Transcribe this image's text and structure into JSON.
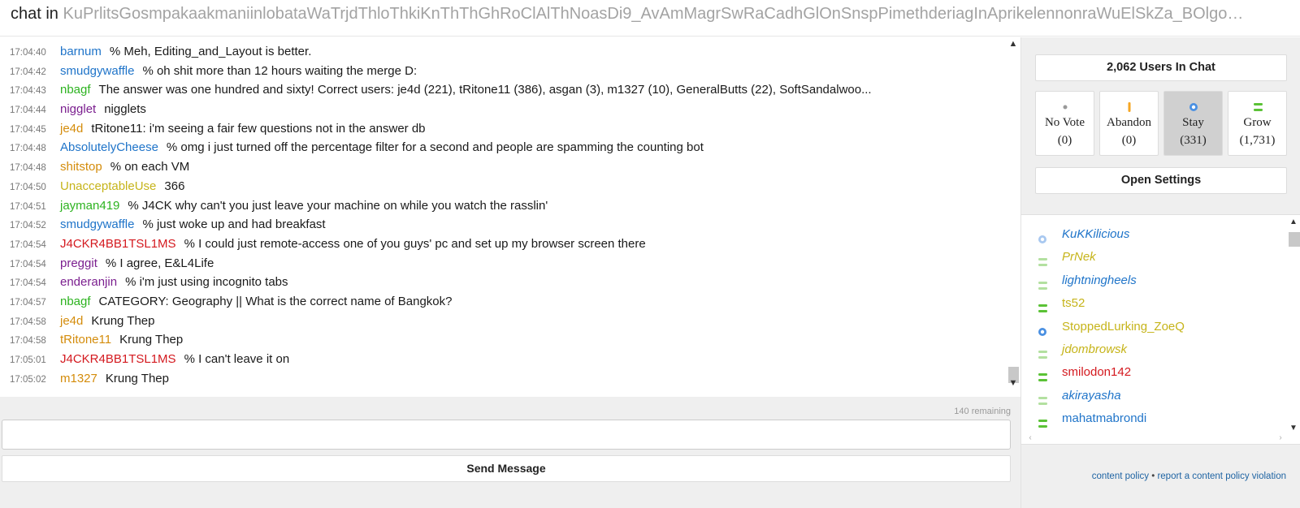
{
  "header": {
    "prefix": "chat in",
    "room": "KuPrlitsGosmpakaakmaniinlobataWaTrjdThloThkiKnThThGhRoClAlThNoasDi9_AvAmMagrSwRaCadhGlOnSnspPimethderiagInAprikelennonraWuElSkZa_BOlgo…"
  },
  "messages": [
    {
      "time": "17:04:40",
      "user": "barnum",
      "color": "#1f74c9",
      "text": "% Meh, Editing_and_Layout is better."
    },
    {
      "time": "17:04:42",
      "user": "smudgywaffle",
      "color": "#1f74c9",
      "text": "% oh shit more than 12 hours waiting the merge D:"
    },
    {
      "time": "17:04:43",
      "user": "nbagf",
      "color": "#2db320",
      "text": "The answer was one hundred and sixty! Correct users: je4d (221), tRitone11 (386), asgan (3), m1327 (10), GeneralButts (22), SoftSandalwoo..."
    },
    {
      "time": "17:04:44",
      "user": "nigglet",
      "color": "#7b1f8f",
      "text": "nigglets"
    },
    {
      "time": "17:04:45",
      "user": "je4d",
      "color": "#d48c0b",
      "text": "tRitone11: i'm seeing a fair few questions not in the answer db"
    },
    {
      "time": "17:04:48",
      "user": "AbsolutelyCheese",
      "color": "#1f74c9",
      "text": "% omg i just turned off the percentage filter for a second and people are spamming the counting bot"
    },
    {
      "time": "17:04:48",
      "user": "shitstop",
      "color": "#d48c0b",
      "text": "% on each VM"
    },
    {
      "time": "17:04:50",
      "user": "UnacceptableUse",
      "color": "#c6b41a",
      "text": "366"
    },
    {
      "time": "17:04:51",
      "user": "jayman419",
      "color": "#2db320",
      "text": "% J4CK why can't you just leave your machine on while you watch the rasslin'"
    },
    {
      "time": "17:04:52",
      "user": "smudgywaffle",
      "color": "#1f74c9",
      "text": "% just woke up and had breakfast"
    },
    {
      "time": "17:04:54",
      "user": "J4CKR4BB1TSL1MS",
      "color": "#d4191f",
      "text": "% I could just remote-access one of you guys' pc and set up my browser screen there"
    },
    {
      "time": "17:04:54",
      "user": "preggit",
      "color": "#7b1f8f",
      "text": "% I agree, E&L4Life"
    },
    {
      "time": "17:04:54",
      "user": "enderanjin",
      "color": "#7b1f8f",
      "text": "% i'm just using incognito tabs"
    },
    {
      "time": "17:04:57",
      "user": "nbagf",
      "color": "#2db320",
      "text": "CATEGORY: Geography || What is the correct name of Bangkok?"
    },
    {
      "time": "17:04:58",
      "user": "je4d",
      "color": "#d48c0b",
      "text": "Krung Thep"
    },
    {
      "time": "17:04:58",
      "user": "tRitone11",
      "color": "#d48c0b",
      "text": "Krung Thep"
    },
    {
      "time": "17:05:01",
      "user": "J4CKR4BB1TSL1MS",
      "color": "#d4191f",
      "text": "% I can't leave it on"
    },
    {
      "time": "17:05:02",
      "user": "m1327",
      "color": "#d48c0b",
      "text": "Krung Thep"
    }
  ],
  "input": {
    "remaining": "140 remaining",
    "placeholder": "",
    "value": "",
    "send_label": "Send Message"
  },
  "sidebar": {
    "user_count": "2,062 Users In Chat",
    "votes": [
      {
        "label": "No Vote",
        "count": "(0)",
        "icon": "dot-icon",
        "selected": false
      },
      {
        "label": "Abandon",
        "count": "(0)",
        "icon": "abandon-icon",
        "selected": false
      },
      {
        "label": "Stay",
        "count": "(331)",
        "icon": "stay-icon",
        "selected": true
      },
      {
        "label": "Grow",
        "count": "(1,731)",
        "icon": "grow-icon",
        "selected": false
      }
    ],
    "settings_label": "Open Settings",
    "users": [
      {
        "name": "KuKKilicious",
        "color": "#1f74c9",
        "italic": true,
        "icon": "stay-icon",
        "faded": true
      },
      {
        "name": "PrNek",
        "color": "#c6b41a",
        "italic": true,
        "icon": "grow-icon",
        "faded": true
      },
      {
        "name": "lightningheels",
        "color": "#1f74c9",
        "italic": true,
        "icon": "grow-icon",
        "faded": true
      },
      {
        "name": "ts52",
        "color": "#c6b41a",
        "italic": false,
        "icon": "grow-icon",
        "faded": false
      },
      {
        "name": "StoppedLurking_ZoeQ",
        "color": "#c6b41a",
        "italic": false,
        "icon": "stay-icon",
        "faded": false
      },
      {
        "name": "jdombrowsk",
        "color": "#c6b41a",
        "italic": true,
        "icon": "grow-icon",
        "faded": true
      },
      {
        "name": "smilodon142",
        "color": "#d4191f",
        "italic": false,
        "icon": "grow-icon",
        "faded": false
      },
      {
        "name": "akirayasha",
        "color": "#1f74c9",
        "italic": true,
        "icon": "grow-icon",
        "faded": true
      },
      {
        "name": "mahatmabrondi",
        "color": "#1f74c9",
        "italic": false,
        "icon": "grow-icon",
        "faded": false
      }
    ],
    "links": {
      "content_policy": "content policy",
      "separator": "•",
      "report": "report a content policy violation"
    }
  },
  "colors": {
    "grow": "#5bc236",
    "stay": "#4a90e2",
    "abandon": "#f5a623",
    "novote": "#999999"
  }
}
